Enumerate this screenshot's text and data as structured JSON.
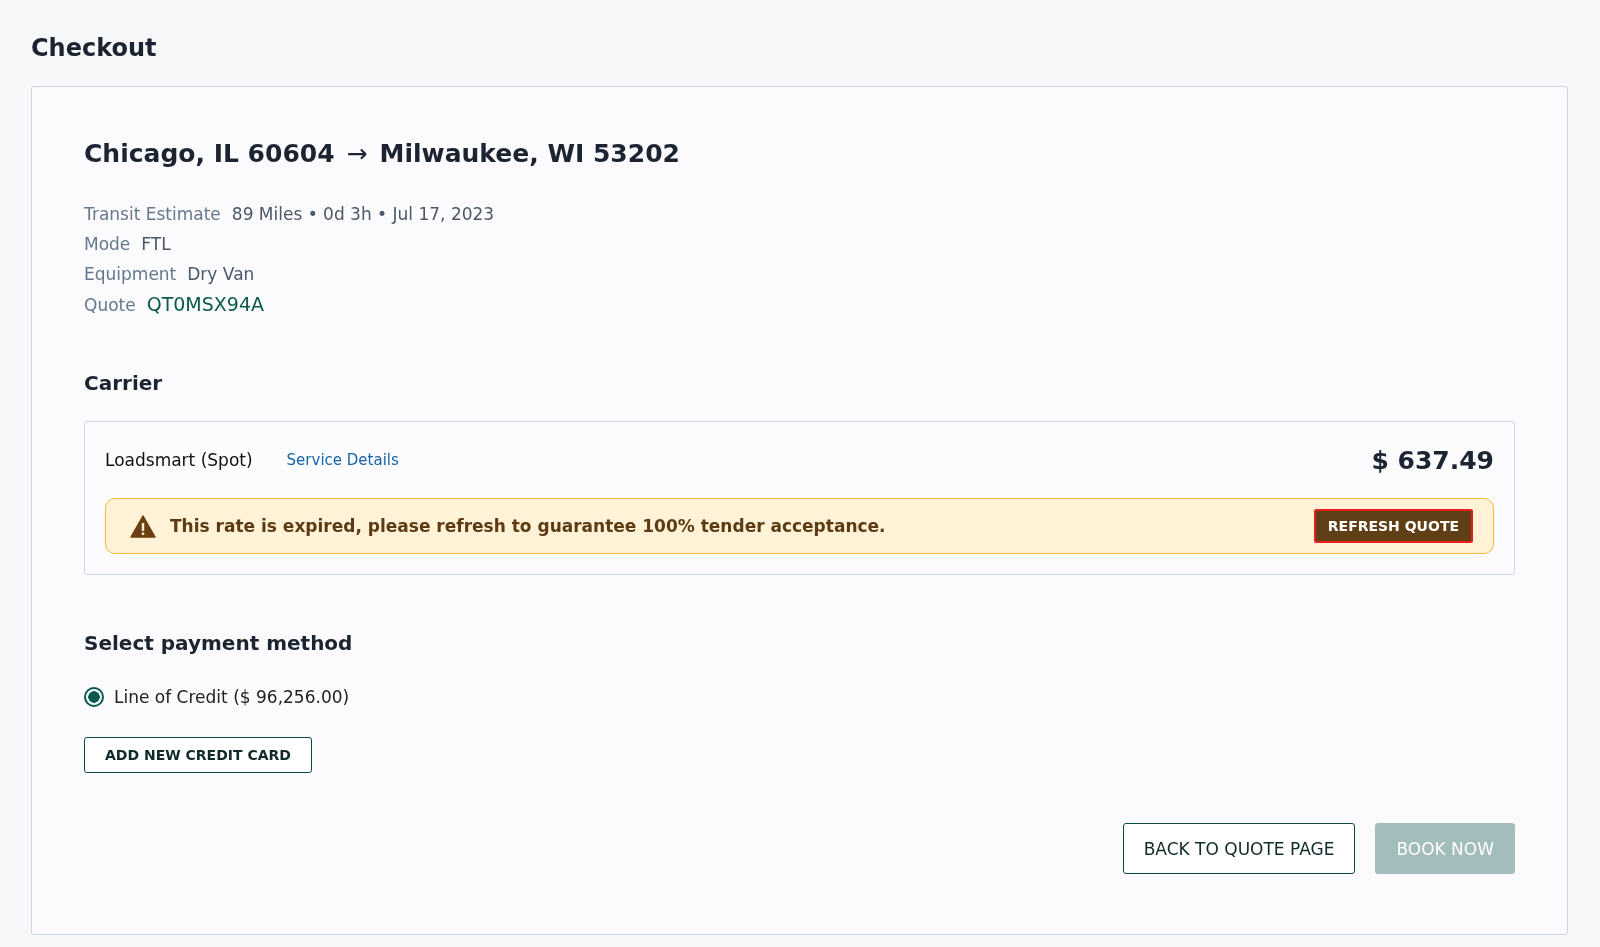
{
  "page": {
    "title": "Checkout"
  },
  "route": {
    "origin": "Chicago, IL 60604",
    "arrow": "→",
    "destination": "Milwaukee, WI 53202"
  },
  "details": [
    {
      "label": "Transit Estimate",
      "value": "89 Miles • 0d 3h • Jul 17, 2023",
      "kind": "text"
    },
    {
      "label": "Mode",
      "value": "FTL",
      "kind": "text"
    },
    {
      "label": "Equipment",
      "value": "Dry Van",
      "kind": "text"
    },
    {
      "label": "Quote",
      "value": "QT0MSX94A",
      "kind": "code"
    }
  ],
  "carrier": {
    "heading": "Carrier",
    "name": "Loadsmart (Spot)",
    "link": "Service Details",
    "price": "$ 637.49",
    "alert": {
      "message": "This rate is expired, please refresh to guarantee 100% tender acceptance.",
      "button": "REFRESH QUOTE",
      "focused": true
    }
  },
  "payment": {
    "heading": "Select payment method",
    "options": [
      {
        "label": "Line of Credit ($ 96,256.00)",
        "selected": true
      }
    ],
    "add_button": "ADD NEW CREDIT CARD"
  },
  "actions": [
    {
      "label": "BACK TO QUOTE PAGE",
      "kind": "secondary",
      "disabled": false
    },
    {
      "label": "BOOK NOW",
      "kind": "primary",
      "disabled": true
    }
  ]
}
